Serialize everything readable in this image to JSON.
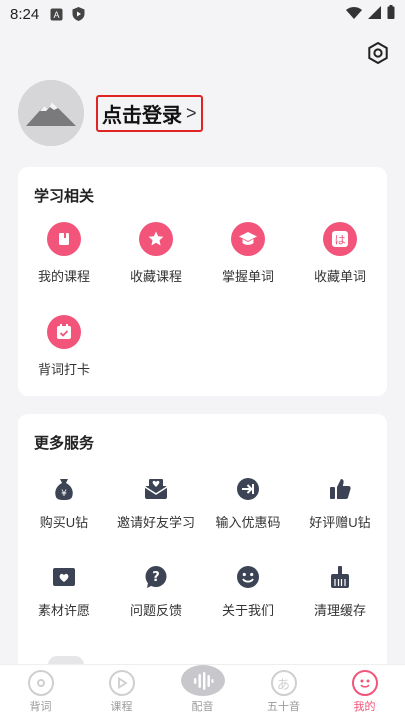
{
  "status": {
    "time": "8:24"
  },
  "profile": {
    "login_label": "点击登录",
    "arrow": ">"
  },
  "study": {
    "title": "学习相关",
    "items": [
      {
        "label": "我的课程",
        "icon": "book-icon"
      },
      {
        "label": "收藏课程",
        "icon": "star-icon"
      },
      {
        "label": "掌握单词",
        "icon": "graduation-cap-icon"
      },
      {
        "label": "收藏单词",
        "icon": "ha-kana-icon"
      },
      {
        "label": "背词打卡",
        "icon": "calendar-check-icon"
      }
    ]
  },
  "services": {
    "title": "更多服务",
    "items": [
      {
        "label": "购买U钻",
        "icon": "money-bag-icon"
      },
      {
        "label": "邀请好友学习",
        "icon": "invite-mail-icon"
      },
      {
        "label": "输入优惠码",
        "icon": "redeem-arrow-icon"
      },
      {
        "label": "好评赠U钻",
        "icon": "thumbs-up-icon"
      },
      {
        "label": "素材许愿",
        "icon": "heart-mail-icon"
      },
      {
        "label": "问题反馈",
        "icon": "question-bubble-icon"
      },
      {
        "label": "关于我们",
        "icon": "smiley-icon"
      },
      {
        "label": "清理缓存",
        "icon": "broom-icon"
      }
    ]
  },
  "tabs": [
    {
      "label": "背词",
      "active": false
    },
    {
      "label": "课程",
      "active": false
    },
    {
      "label": "配音",
      "active": false
    },
    {
      "label": "五十音",
      "active": false
    },
    {
      "label": "我的",
      "active": true
    }
  ],
  "colors": {
    "accent": "#f2547a",
    "highlight": "#e02424"
  }
}
